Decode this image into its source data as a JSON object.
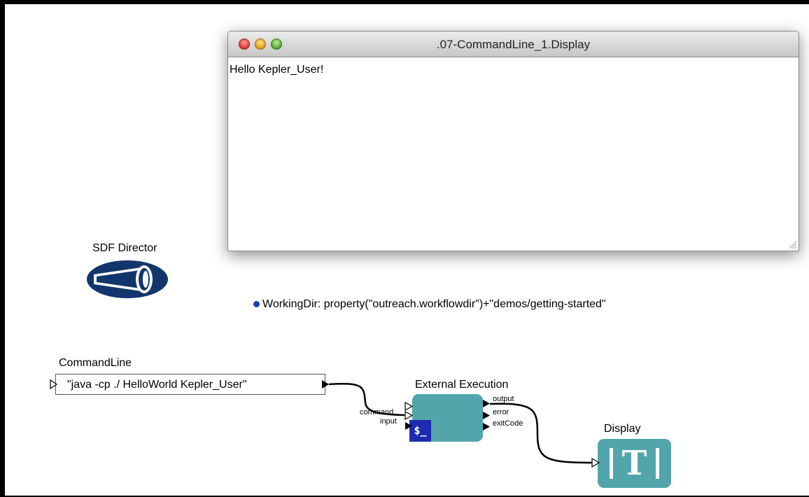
{
  "display_window": {
    "title": ".07-CommandLine_1.Display",
    "content": "Hello Kepler_User!"
  },
  "director": {
    "label": "SDF Director"
  },
  "parameter": {
    "text": "WorkingDir: property(\"outreach.workflowdir\")+\"demos/getting-started\""
  },
  "command_line": {
    "label": "CommandLine",
    "value": "\"java -cp ./ HelloWorld Kepler_User\""
  },
  "external_execution": {
    "label": "External Execution",
    "icon_text": "$_",
    "input_ports": [
      "command",
      "input"
    ],
    "output_ports": [
      "output",
      "error",
      "exitCode"
    ]
  },
  "display_actor": {
    "label": "Display",
    "icon_text": "T"
  },
  "colors": {
    "actor": "#52a6ab",
    "terminal": "#1d2bb0",
    "param_dot": "#1f3cb3"
  }
}
